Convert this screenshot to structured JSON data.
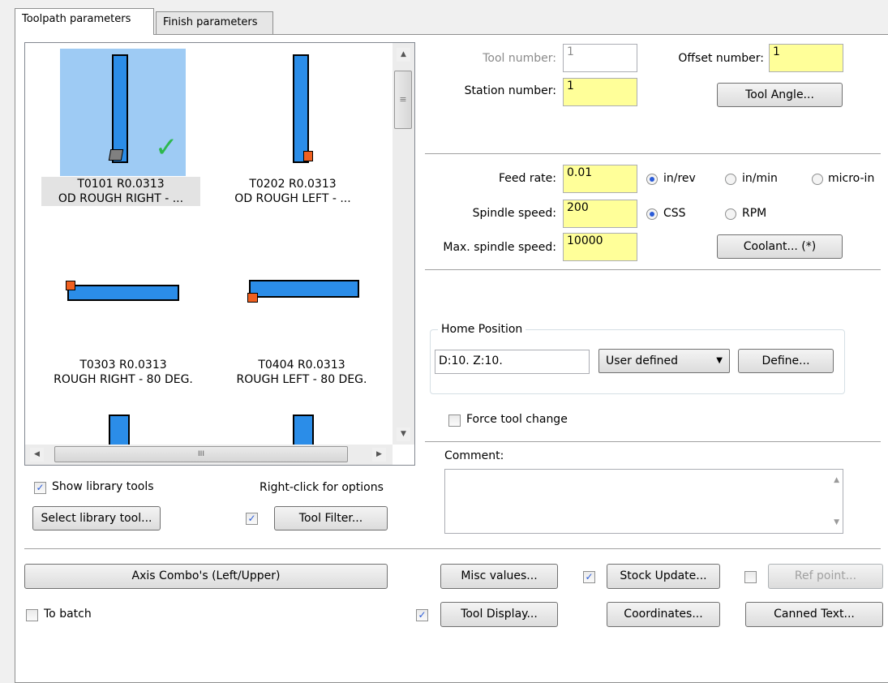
{
  "tabs": [
    "Toolpath parameters",
    "Finish parameters"
  ],
  "tools": [
    {
      "id": "T0101 R0.0313",
      "name": "OD ROUGH RIGHT - ..."
    },
    {
      "id": "T0202 R0.0313",
      "name": "OD ROUGH LEFT - ..."
    },
    {
      "id": "T0303 R0.0313",
      "name": "ROUGH RIGHT - 80 DEG."
    },
    {
      "id": "T0404 R0.0313",
      "name": "ROUGH LEFT - 80 DEG."
    }
  ],
  "selected_check": "✓",
  "scroll": {
    "up": "▲",
    "down": "▼",
    "left": "◀",
    "right": "▶",
    "grip_h": "III",
    "grip_v": "≡"
  },
  "library": {
    "show_label": "Show library tools",
    "hint": "Right-click for options",
    "select_button": "Select library tool...",
    "filter_button": "Tool Filter..."
  },
  "tool_numbers": {
    "tool_number_label": "Tool number:",
    "tool_number": "1",
    "offset_label": "Offset number:",
    "offset": "1",
    "station_label": "Station number:",
    "station": "1",
    "tool_angle_button": "Tool Angle..."
  },
  "feeds": {
    "feed_label": "Feed rate:",
    "feed": "0.01",
    "feed_units": [
      "in/rev",
      "in/min",
      "micro-in"
    ],
    "spindle_label": "Spindle speed:",
    "spindle": "200",
    "spindle_modes": [
      "CSS",
      "RPM"
    ],
    "max_label": "Max. spindle speed:",
    "max": "10000",
    "coolant_button": "Coolant... (*)"
  },
  "home": {
    "legend": "Home Position",
    "value": "D:10.  Z:10.",
    "mode": "User defined",
    "define_button": "Define..."
  },
  "force_tool_change": "Force tool change",
  "comment_label": "Comment:",
  "bottom": {
    "axis_combo": "Axis Combo's (Left/Upper)",
    "misc_values": "Misc values...",
    "stock_update": "Stock Update...",
    "ref_point": "Ref point...",
    "to_batch": "To batch",
    "tool_display": "Tool Display...",
    "coordinates": "Coordinates...",
    "canned_text": "Canned Text..."
  },
  "colors": {
    "selection": "#9ecbf4",
    "field_yellow": "#ffff99",
    "tool_blue": "#2b8de8",
    "insert_orange": "#f06020",
    "check_green": "#2db84d"
  }
}
